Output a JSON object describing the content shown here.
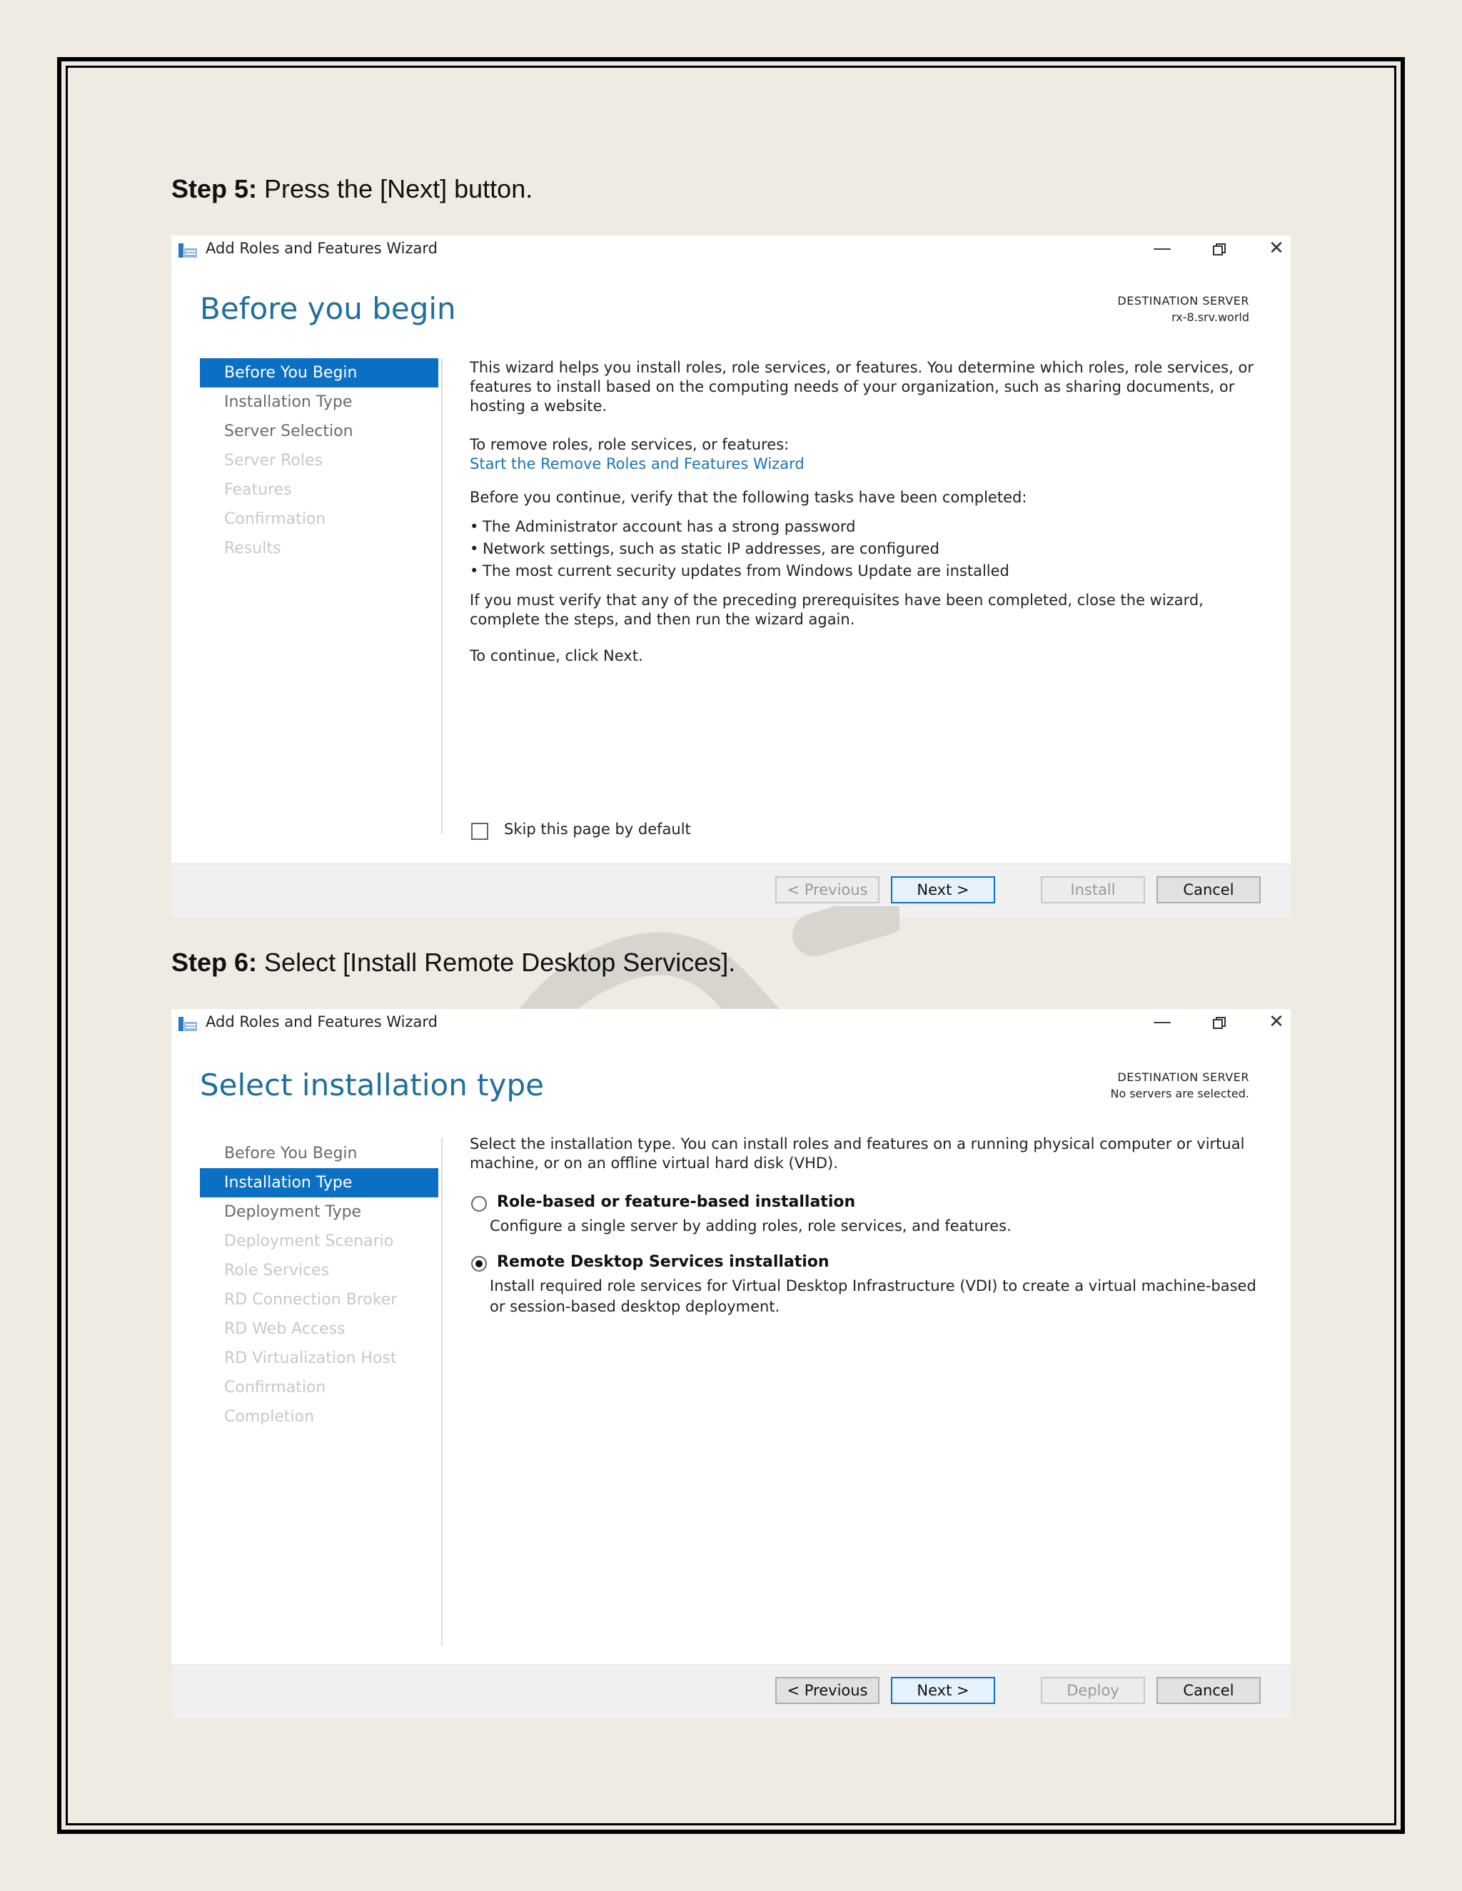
{
  "step5": {
    "label": "Step 5:",
    "text": " Press the [Next] button."
  },
  "step6": {
    "label": "Step 6:",
    "text": " Select [Install Remote Desktop Services]."
  },
  "wizard1": {
    "title": "Add Roles and Features Wizard",
    "heading": "Before you begin",
    "dest_label": "DESTINATION SERVER",
    "dest_value": "rx-8.srv.world",
    "nav": [
      "Before You Begin",
      "Installation Type",
      "Server Selection",
      "Server Roles",
      "Features",
      "Confirmation",
      "Results"
    ],
    "intro": "This wizard helps you install roles, role services, or features. You determine which roles, role services, or features to install based on the computing needs of your organization, such as sharing documents, or hosting a website.",
    "remove_text": "To remove roles, role services, or features:",
    "remove_link": "Start the Remove Roles and Features Wizard",
    "verify_text": "Before you continue, verify that the following tasks have been completed:",
    "bullets": [
      "The Administrator account has a strong password",
      "Network settings, such as static IP addresses, are configured",
      "The most current security updates from Windows Update are installed"
    ],
    "prereq_text": "If you must verify that any of the preceding prerequisites have been completed, close the wizard, complete the steps, and then run the wizard again.",
    "continue_text": "To continue, click Next.",
    "skip_label": "Skip this page by default",
    "btn_previous": "< Previous",
    "btn_next": "Next >",
    "btn_install": "Install",
    "btn_cancel": "Cancel"
  },
  "wizard2": {
    "title": "Add Roles and Features Wizard",
    "heading": "Select installation type",
    "dest_label": "DESTINATION SERVER",
    "dest_value": "No servers are selected.",
    "nav": [
      "Before You Begin",
      "Installation Type",
      "Deployment Type",
      "Deployment Scenario",
      "Role Services",
      "RD Connection Broker",
      "RD Web Access",
      "RD Virtualization Host",
      "Confirmation",
      "Completion"
    ],
    "intro": "Select the installation type. You can install roles and features on a running physical computer or virtual machine, or on an offline virtual hard disk (VHD).",
    "opt1_title": "Role-based or feature-based installation",
    "opt1_desc": "Configure a single server by adding roles, role services, and features.",
    "opt2_title": "Remote Desktop Services installation",
    "opt2_desc": "Install required role services for Virtual Desktop Infrastructure (VDI) to create a virtual machine-based or session-based desktop deployment.",
    "btn_previous": "< Previous",
    "btn_next": "Next >",
    "btn_deploy": "Deploy",
    "btn_cancel": "Cancel"
  },
  "colors": {
    "accent": "#0b6fc4",
    "heading": "#1f6f9c",
    "link": "#1a74b5",
    "page_bg": "#efebe3"
  },
  "icons": {
    "app": "server-manager-icon",
    "minimize": "minimize-icon",
    "restore": "restore-icon",
    "close": "close-icon"
  }
}
